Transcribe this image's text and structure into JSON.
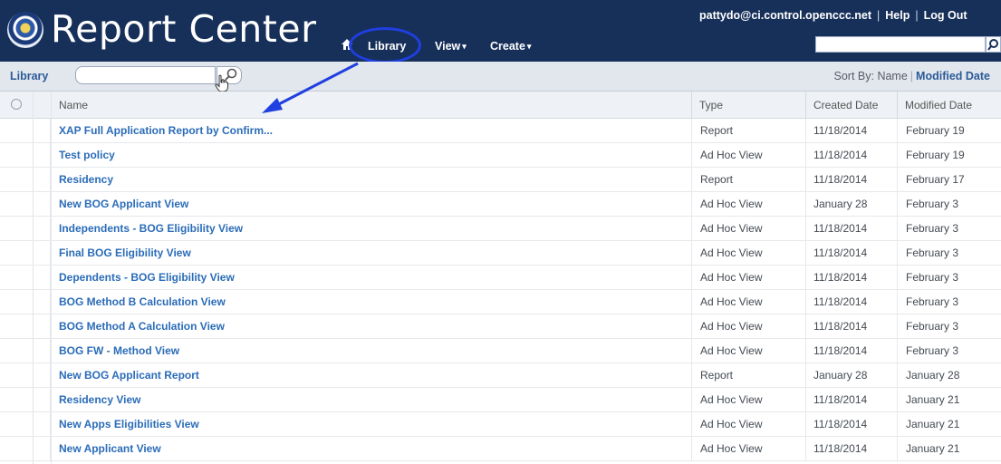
{
  "header": {
    "app_title": "Report Center",
    "nav": {
      "library": "Library",
      "view": "View",
      "create": "Create"
    },
    "user": "pattydo@ci.control.openccc.net",
    "help": "Help",
    "logout": "Log Out"
  },
  "toolbar": {
    "label": "Library",
    "search_placeholder": "",
    "sort_by_label": "Sort By:",
    "sort_name": "Name",
    "sort_modified": "Modified Date"
  },
  "table": {
    "columns": {
      "name": "Name",
      "type": "Type",
      "created": "Created Date",
      "modified": "Modified Date"
    },
    "rows": [
      {
        "name": "XAP Full Application Report by Confirm...",
        "type": "Report",
        "created": "11/18/2014",
        "modified": "February 19"
      },
      {
        "name": "Test policy",
        "type": "Ad Hoc View",
        "created": "11/18/2014",
        "modified": "February 19"
      },
      {
        "name": "Residency",
        "type": "Report",
        "created": "11/18/2014",
        "modified": "February 17"
      },
      {
        "name": "New BOG Applicant View",
        "type": "Ad Hoc View",
        "created": "January 28",
        "modified": "February 3"
      },
      {
        "name": "Independents - BOG Eligibility View",
        "type": "Ad Hoc View",
        "created": "11/18/2014",
        "modified": "February 3"
      },
      {
        "name": "Final BOG Eligibility View",
        "type": "Ad Hoc View",
        "created": "11/18/2014",
        "modified": "February 3"
      },
      {
        "name": "Dependents - BOG Eligibility View",
        "type": "Ad Hoc View",
        "created": "11/18/2014",
        "modified": "February 3"
      },
      {
        "name": "BOG Method B Calculation View",
        "type": "Ad Hoc View",
        "created": "11/18/2014",
        "modified": "February 3"
      },
      {
        "name": "BOG Method A Calculation View",
        "type": "Ad Hoc View",
        "created": "11/18/2014",
        "modified": "February 3"
      },
      {
        "name": "BOG FW - Method View",
        "type": "Ad Hoc View",
        "created": "11/18/2014",
        "modified": "February 3"
      },
      {
        "name": "New BOG Applicant Report",
        "type": "Report",
        "created": "January 28",
        "modified": "January 28"
      },
      {
        "name": "Residency View",
        "type": "Ad Hoc View",
        "created": "11/18/2014",
        "modified": "January 21"
      },
      {
        "name": "New Apps Eligibilities View",
        "type": "Ad Hoc View",
        "created": "11/18/2014",
        "modified": "January 21"
      },
      {
        "name": "New Applicant View",
        "type": "Ad Hoc View",
        "created": "11/18/2014",
        "modified": "January 21"
      }
    ]
  },
  "colors": {
    "header_bg": "#17305a",
    "link": "#2b6cb8",
    "annotation": "#1f3fe0"
  },
  "icons": [
    "logo-seal-icon",
    "home-icon",
    "search-icon",
    "clock-icon",
    "cursor-hand-icon"
  ]
}
